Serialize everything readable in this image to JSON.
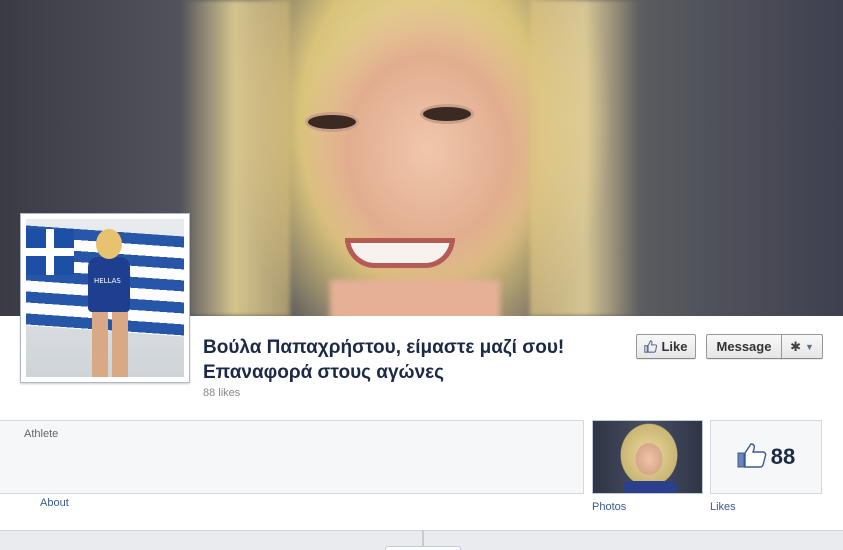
{
  "page": {
    "title_line1": "Βούλα Παπαχρήστου, είμαστε μαζί σου!",
    "title_line2": "Επαναφορά στους αγώνες",
    "likes_subtitle": "88 likes"
  },
  "cover": {
    "description_icon": "cover-photo"
  },
  "profile_picture": {
    "jersey_text": "HELLAS"
  },
  "actions": {
    "like_label": "Like",
    "message_label": "Message",
    "gear_icon": "gear-icon",
    "chevron_icon": "chevron-down-icon"
  },
  "about": {
    "category": "Athlete",
    "link_label": "About"
  },
  "photos": {
    "label": "Photos"
  },
  "likes": {
    "count": "88",
    "label": "Likes"
  },
  "colors": {
    "title": "#1c2a47",
    "link": "#3b5998",
    "box_bg": "#f6f7f9",
    "box_border": "#d3d8e0"
  }
}
